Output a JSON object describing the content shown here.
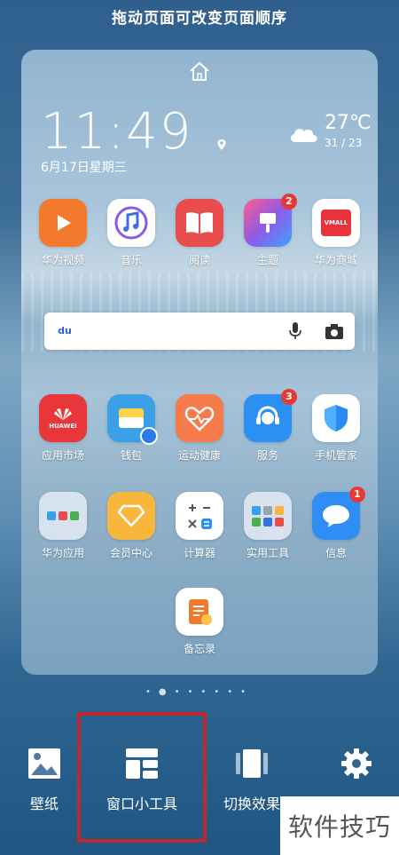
{
  "hint": "拖动页面可改变页面顺序",
  "clock": {
    "time": "11:49",
    "date": "6月17日星期三",
    "temp": "27℃",
    "range": "31 / 23"
  },
  "apps_row1": [
    {
      "name": "华为视频",
      "color": "#f37a2c",
      "badge": ""
    },
    {
      "name": "音乐",
      "color": "#ffffff",
      "badge": ""
    },
    {
      "name": "阅读",
      "color": "#e84c4c",
      "badge": ""
    },
    {
      "name": "主题",
      "color": "#8f5ae6",
      "badge": "2"
    },
    {
      "name": "华为商城",
      "color": "#ffffff",
      "badge": ""
    }
  ],
  "apps_row2": [
    {
      "name": "应用市场",
      "color": "#e8363a",
      "badge": ""
    },
    {
      "name": "钱包",
      "color": "#3aa0e8",
      "badge": ""
    },
    {
      "name": "运动健康",
      "color": "#f57c4a",
      "badge": ""
    },
    {
      "name": "服务",
      "color": "#2c8ff2",
      "badge": "3"
    },
    {
      "name": "手机管家",
      "color": "#ffffff",
      "badge": ""
    }
  ],
  "apps_row3": [
    {
      "name": "华为应用",
      "color": "#dfe8f2",
      "badge": ""
    },
    {
      "name": "会员中心",
      "color": "#f6b73c",
      "badge": ""
    },
    {
      "name": "计算器",
      "color": "#ffffff",
      "badge": ""
    },
    {
      "name": "实用工具",
      "color": "#dfe8f2",
      "badge": ""
    },
    {
      "name": "信息",
      "color": "#2f8ef5",
      "badge": "1"
    }
  ],
  "apps_row4": [
    {
      "name": "备忘录",
      "color": "#ffffff",
      "badge": ""
    }
  ],
  "icon_texts": {
    "appgallery": "HUAWEI",
    "vmall": "VMALL",
    "search_logo": "du"
  },
  "bottom": [
    {
      "label": "壁纸",
      "icon": "wallpaper-icon"
    },
    {
      "label": "窗口小工具",
      "icon": "widget-icon"
    },
    {
      "label": "切换效果",
      "icon": "transition-icon"
    },
    {
      "label": "",
      "icon": "settings-icon"
    }
  ],
  "watermark": "软件技巧"
}
